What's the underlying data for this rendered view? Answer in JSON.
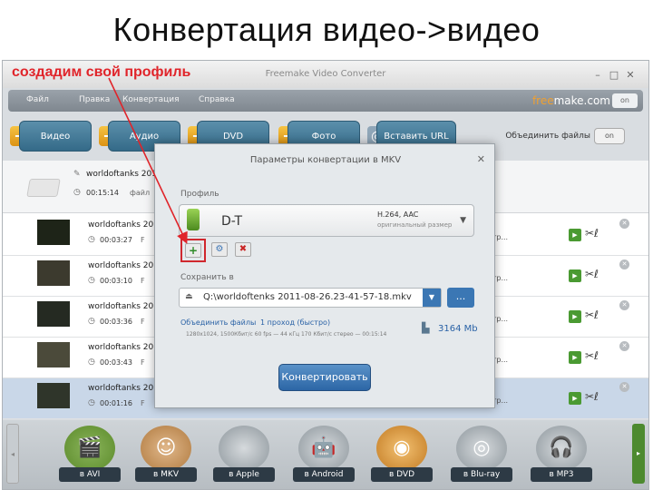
{
  "slide": {
    "title": "Конвертация видео->видео"
  },
  "annotation": {
    "text": "создадим свой профиль",
    "color": "#e0242a"
  },
  "app": {
    "title": "Freemake Video Converter",
    "window_controls": [
      "–",
      "□",
      "✕"
    ],
    "menu": [
      "Файл",
      "Правка",
      "Конвертация",
      "Справка"
    ],
    "brand": {
      "orange": "free",
      "rest": "make.com"
    },
    "brand_toggle": "on"
  },
  "toolbar": {
    "buttons": [
      "Видео",
      "Аудио",
      "DVD",
      "Фото",
      "Вставить URL"
    ],
    "merge_label": "Объединить файлы",
    "merge_toggle": "on"
  },
  "list": {
    "group": {
      "name": "worldoftanks 2011",
      "duration": "00:15:14",
      "files": "файл"
    },
    "rows": [
      {
        "name": "worldoftanks 2011",
        "duration": "00:03:27",
        "icon_letter": "F",
        "tag": "утр..."
      },
      {
        "name": "worldoftanks 2011",
        "duration": "00:03:10",
        "icon_letter": "F",
        "tag": "утр..."
      },
      {
        "name": "worldoftanks 2011",
        "duration": "00:03:36",
        "icon_letter": "F",
        "tag": "утр..."
      },
      {
        "name": "worldoftanks 2011",
        "duration": "00:03:43",
        "icon_letter": "F",
        "tag": "утр..."
      },
      {
        "name": "worldoftanks 2011",
        "duration": "00:01:16",
        "icon_letter": "F",
        "tag": "утр..."
      }
    ]
  },
  "dialog": {
    "title": "Параметры конвертации в MKV",
    "close": "✕",
    "profile_label": "Профиль",
    "profile_name": "D-T",
    "codec": "H.264, AAC",
    "codec_note": "оригинальный размер",
    "add": "+",
    "settings": "⚙",
    "remove": "✖",
    "save_label": "Сохранить в",
    "save_path": "Q:\\worldoftenks 2011-08-26.23-41-57-18.mkv",
    "browse": "...",
    "merge_link": "Объединить файлы",
    "pass_link": "1 проход (быстро)",
    "stats": "1280x1024, 1500Кбит/с 60 fps — 44 кГц 170 Кбит/с стерео — 00:15:14",
    "size": "3164 Mb",
    "convert": "Конвертировать"
  },
  "formats": [
    "в AVI",
    "в MKV",
    "в Apple",
    "в Android",
    "в DVD",
    "в Blu-ray",
    "в MP3"
  ],
  "icons": {
    "format_glyphs": [
      "🎬",
      "☺",
      "",
      "🤖",
      "◉",
      "◎",
      "🎧"
    ],
    "plus": "+",
    "pencil": "✎",
    "clock": "◷",
    "play": "▶",
    "scissors": "✂ℓ",
    "row_close": "✕",
    "scroll_left": "◂",
    "scroll_right": "▸",
    "caret": "▼",
    "path_drop": "▼",
    "folder": "⏏",
    "size_icon": "▙",
    "globe": "◎"
  }
}
